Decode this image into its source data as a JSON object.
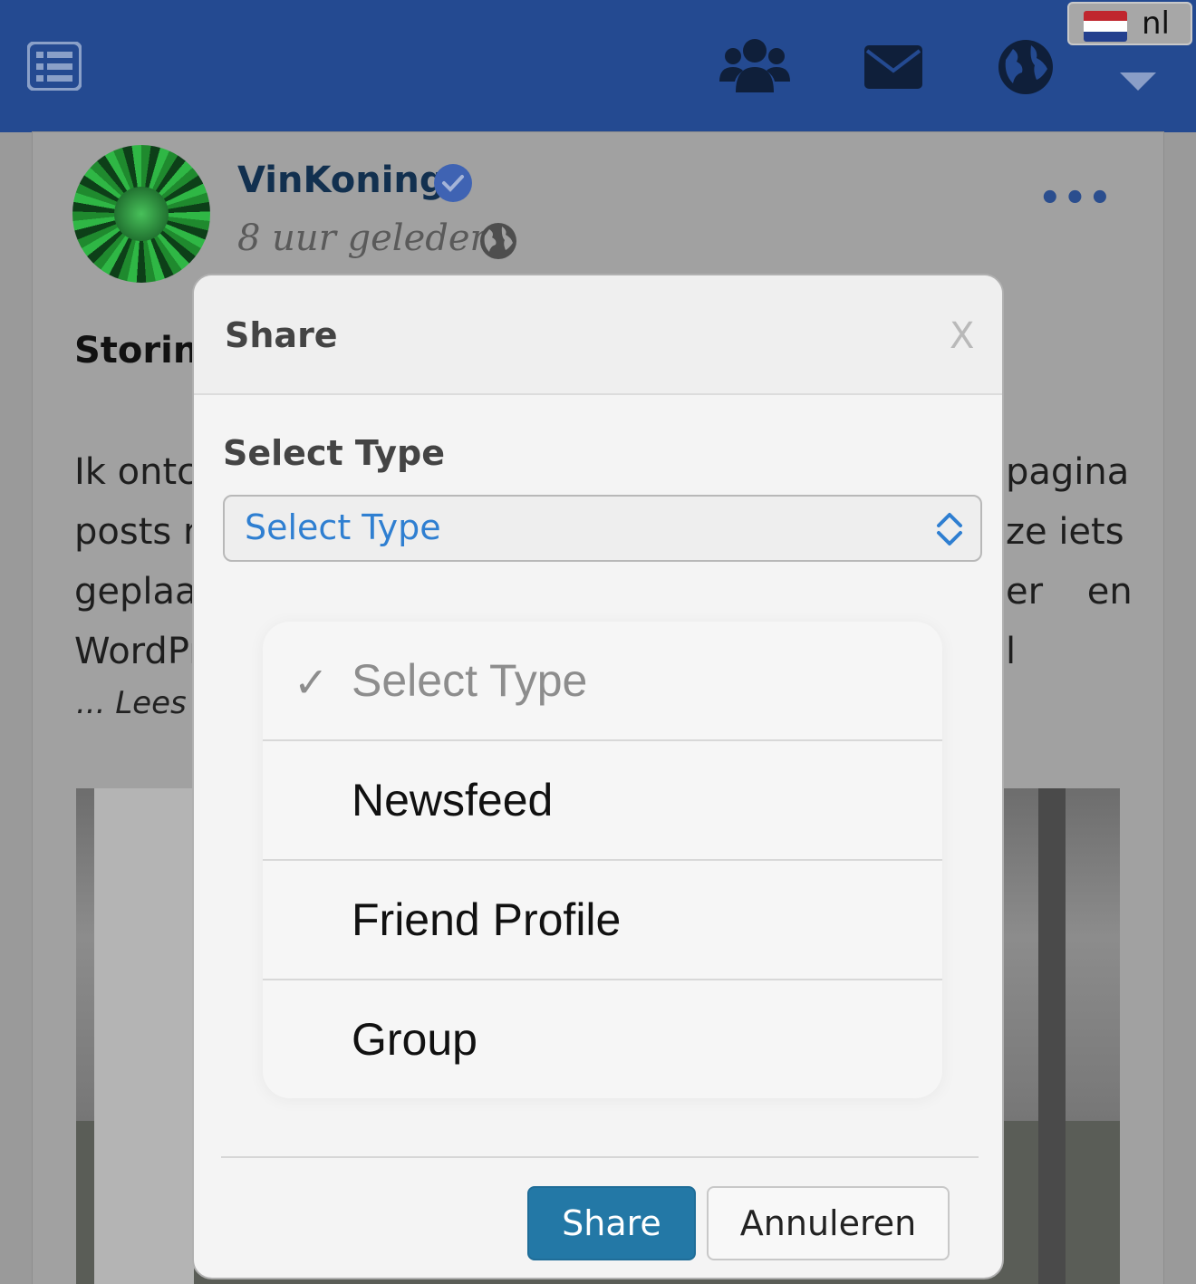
{
  "topbar": {
    "language_code": "nl",
    "brand_color": "#244a91",
    "icons": [
      "list-menu-icon",
      "friends-icon",
      "envelope-icon",
      "globe-icon",
      "netherlands-flag-icon",
      "caret-down-icon"
    ]
  },
  "post": {
    "author": "VinKonings",
    "timestamp": "8 uur geleden -",
    "title_fragment": "Storing",
    "lines": [
      {
        "left": "Ik ontc",
        "right": "pagina"
      },
      {
        "left": "posts r",
        "right": "ze iets"
      },
      {
        "left": "geplaa",
        "right": "er en"
      },
      {
        "left": "WordPr",
        "right": "l"
      }
    ],
    "read_more": "... Lees M"
  },
  "modal": {
    "title": "Share",
    "close_label": "X",
    "field_label": "Select Type",
    "select": {
      "value": "Select Type"
    },
    "options": [
      {
        "label": "Select Type",
        "selected": true
      },
      {
        "label": "Newsfeed",
        "selected": false
      },
      {
        "label": "Friend Profile",
        "selected": false
      },
      {
        "label": "Group",
        "selected": false
      }
    ],
    "share_button": "Share",
    "cancel_button": "Annuleren",
    "accent_color": "#2378a6"
  }
}
